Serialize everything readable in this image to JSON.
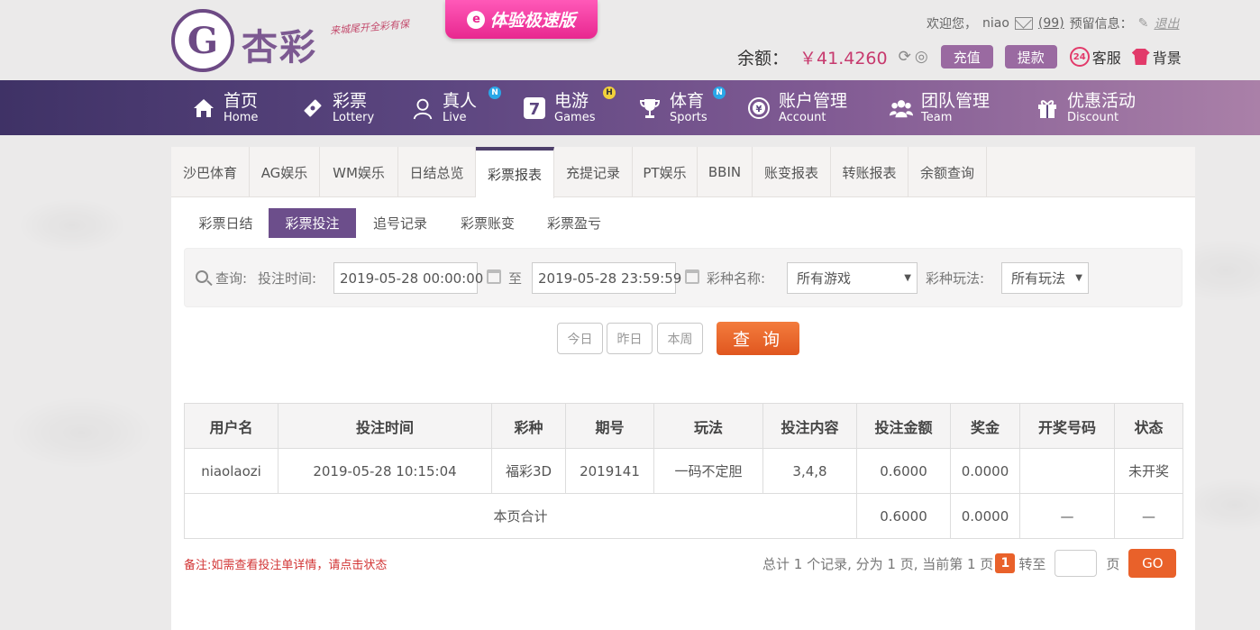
{
  "brand": {
    "logo_letter": "G",
    "name": "杏彩",
    "slogan": "来城尾开全彩有保"
  },
  "header": {
    "speed_label": "体验极速版",
    "speed_icon": "e",
    "welcome": "欢迎您，",
    "username": "niao",
    "message_count": "(99)",
    "reserve_label": "预留信息：",
    "logout": "退出",
    "balance_label": "余额：",
    "balance_value": "￥41.4260",
    "deposit": "充值",
    "withdraw": "提款",
    "service": "客服",
    "service_icon_text": "24",
    "background": "背景"
  },
  "nav": [
    {
      "cn": "首页",
      "en": "Home",
      "icon": "home-icon"
    },
    {
      "cn": "彩票",
      "en": "Lottery",
      "icon": "lottery-icon"
    },
    {
      "cn": "真人",
      "en": "Live",
      "icon": "live-dealer-icon",
      "badge": "N"
    },
    {
      "cn": "电游",
      "en": "Games",
      "icon": "slot-seven-icon",
      "badge": "H"
    },
    {
      "cn": "体育",
      "en": "Sports",
      "icon": "trophy-icon",
      "badge": "N"
    },
    {
      "cn": "账户管理",
      "en": "Account",
      "icon": "account-icon"
    },
    {
      "cn": "团队管理",
      "en": "Team",
      "icon": "team-icon"
    },
    {
      "cn": "优惠活动",
      "en": "Discount",
      "icon": "gift-icon"
    }
  ],
  "tabs": [
    "沙巴体育",
    "AG娱乐",
    "WM娱乐",
    "日结总览",
    "彩票报表",
    "充提记录",
    "PT娱乐",
    "BBIN",
    "账变报表",
    "转账报表",
    "余额查询"
  ],
  "subtabs": [
    "彩票日结",
    "彩票投注",
    "追号记录",
    "彩票账变",
    "彩票盈亏"
  ],
  "filter": {
    "query_label": "查询:",
    "bet_time_label": "投注时间:",
    "start": "2019-05-28 00:00:00",
    "to": "至",
    "end": "2019-05-28 23:59:59",
    "game_name_label": "彩种名称:",
    "game_name_value": "所有游戏",
    "play_label": "彩种玩法:",
    "play_value": "所有玩法"
  },
  "quick": [
    "今日",
    "昨日",
    "本周"
  ],
  "search": "查 询",
  "table": {
    "headers": [
      "用户名",
      "投注时间",
      "彩种",
      "期号",
      "玩法",
      "投注内容",
      "投注金额",
      "奖金",
      "开奖号码",
      "状态"
    ],
    "row": [
      "niaolaozi",
      "2019-05-28 10:15:04",
      "福彩3D",
      "2019141",
      "一码不定胆",
      "3,4,8",
      "0.6000",
      "0.0000",
      "",
      "未开奖"
    ],
    "total": {
      "label": "本页合计",
      "amount": "0.6000",
      "bonus": "0.0000",
      "draw": "—",
      "status": "—"
    }
  },
  "note": "备注:如需查看投注单详情，请点击状态",
  "pager": {
    "summary": "总计 1 个记录, 分为 1 页, 当前第 1 页",
    "current": "1",
    "goto": "转至",
    "page": "页",
    "go": "GO"
  },
  "colors": {
    "accent": "#6c4e8b",
    "orange": "#e9612a",
    "pink": "#e8278f",
    "status_green": "#2b8a1e"
  }
}
